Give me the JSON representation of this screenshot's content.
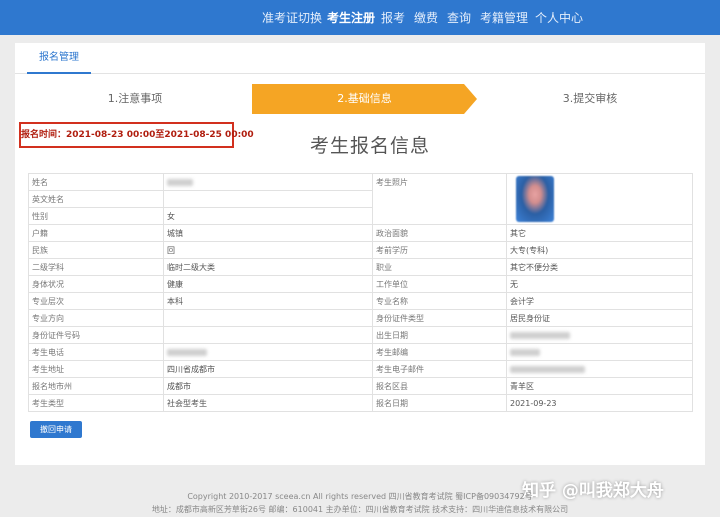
{
  "nav": {
    "items": [
      "准考证切换",
      "考生注册",
      "报考",
      "缴费",
      "查询",
      "考籍管理",
      "个人中心"
    ],
    "active_index": 1
  },
  "tab": {
    "label": "报名管理"
  },
  "steps": [
    "1.注意事项",
    "2.基础信息",
    "3.提交审核"
  ],
  "active_step": 1,
  "registration_time": "报名时间：2021-08-23 00:00至2021-08-25 00:00",
  "form_title": "考生报名信息",
  "table": {
    "name_label": "姓名",
    "photo_label": "考生照片",
    "english_name_label": "英文姓名",
    "gender_label": "性别",
    "gender_value": "女",
    "rows": [
      [
        "户籍",
        "城镇",
        "政治面貌",
        "其它"
      ],
      [
        "民族",
        "回",
        "考前学历",
        "大专(专科)"
      ],
      [
        "二级学科",
        "临时二级大类",
        "职业",
        "其它不便分类"
      ],
      [
        "身体状况",
        "健康",
        "工作单位",
        "无"
      ],
      [
        "专业层次",
        "本科",
        "专业名称",
        "会计学"
      ],
      [
        "专业方向",
        "",
        "身份证件类型",
        "居民身份证"
      ],
      [
        "身份证件号码",
        "",
        "出生日期",
        ""
      ],
      [
        "考生电话",
        "",
        "考生邮编",
        ""
      ],
      [
        "考生地址",
        "四川省成都市",
        "考生电子邮件",
        ""
      ],
      [
        "报名地市州",
        "成都市",
        "报名区县",
        "青羊区"
      ],
      [
        "考生类型",
        "社会型考生",
        "报名日期",
        "2021-09-23"
      ]
    ]
  },
  "cancel_button": "撤回申请",
  "footer": {
    "line1": "Copyright 2010-2017 sceea.cn All rights reserved 四川省教育考试院 蜀ICP备09034792号",
    "line2": "地址：成都市高新区芳草街26号 邮编：610041 主办单位：四川省教育考试院 技术支持：四川华迪信息技术有限公司"
  },
  "watermark": "知乎 @叫我郑大舟",
  "colors": {
    "brand": "#2f78cf",
    "step_active": "#f5a524",
    "alert": "#d2301e"
  }
}
